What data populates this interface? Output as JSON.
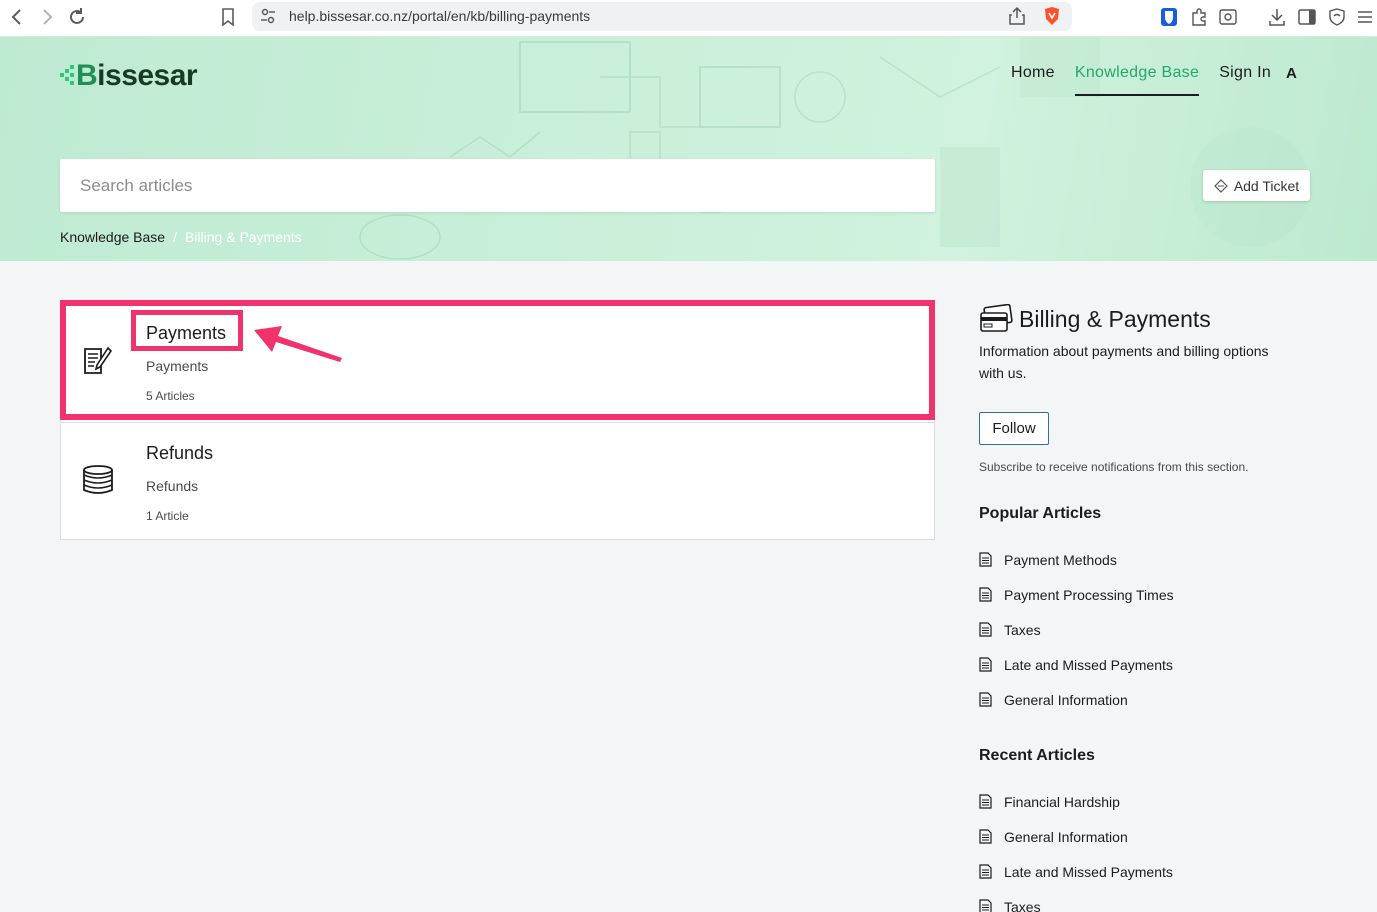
{
  "browser": {
    "url": "help.bissesar.co.nz/portal/en/kb/billing-payments"
  },
  "header": {
    "logo_text": "issesar",
    "logo_letter": "B",
    "nav": [
      {
        "label": "Home",
        "active": false
      },
      {
        "label": "Knowledge Base",
        "active": true
      },
      {
        "label": "Sign In",
        "active": false
      }
    ],
    "a11y_label": "A",
    "search_placeholder": "Search articles",
    "add_ticket_label": "Add Ticket"
  },
  "breadcrumb": {
    "root": "Knowledge Base",
    "separator": "/",
    "current": "Billing & Payments"
  },
  "sections": [
    {
      "title": "Payments",
      "description": "Payments",
      "count": "5 Articles",
      "icon": "document-pen-icon"
    },
    {
      "title": "Refunds",
      "description": "Refunds",
      "count": "1 Article",
      "icon": "coin-stack-icon"
    }
  ],
  "sidebar": {
    "icon": "credit-card-icon",
    "title": "Billing & Payments",
    "description": "Information about payments and billing options with us.",
    "follow_label": "Follow",
    "subscribe_text": "Subscribe to receive notifications from this section.",
    "popular_heading": "Popular Articles",
    "popular": [
      "Payment Methods",
      "Payment Processing Times",
      "Taxes",
      "Late and Missed Payments",
      "General Information"
    ],
    "recent_heading": "Recent Articles",
    "recent": [
      "Financial Hardship",
      "General Information",
      "Late and Missed Payments",
      "Taxes"
    ]
  },
  "colors": {
    "accent": "#23a867",
    "annotation": "#f0336c",
    "hero_bg": "#c8efd9"
  }
}
